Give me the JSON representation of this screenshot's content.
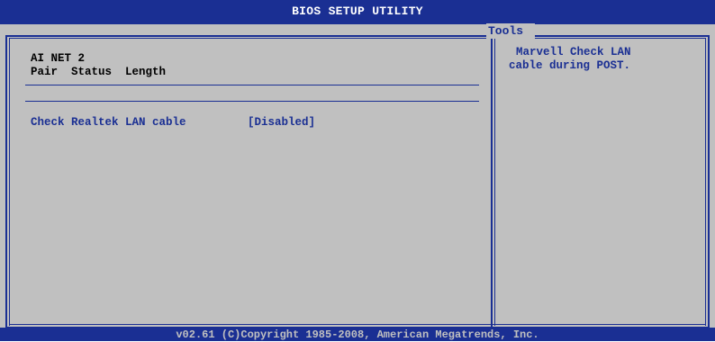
{
  "window": {
    "title": "BIOS SETUP UTILITY",
    "active_tab": "Tools"
  },
  "main": {
    "section_title": "AI NET 2",
    "columns_header": "Pair  Status  Length",
    "items": [
      {
        "label": "Check Realtek LAN cable",
        "value": "[Disabled]"
      }
    ]
  },
  "help": {
    "lines": [
      "Marvell Check LAN",
      "cable during POST."
    ]
  },
  "footer": {
    "copyright": "v02.61 (C)Copyright 1985-2008, American Megatrends, Inc."
  },
  "colors": {
    "background": "#c0c0c0",
    "accent": "#1a2f93",
    "text": "#000000"
  }
}
